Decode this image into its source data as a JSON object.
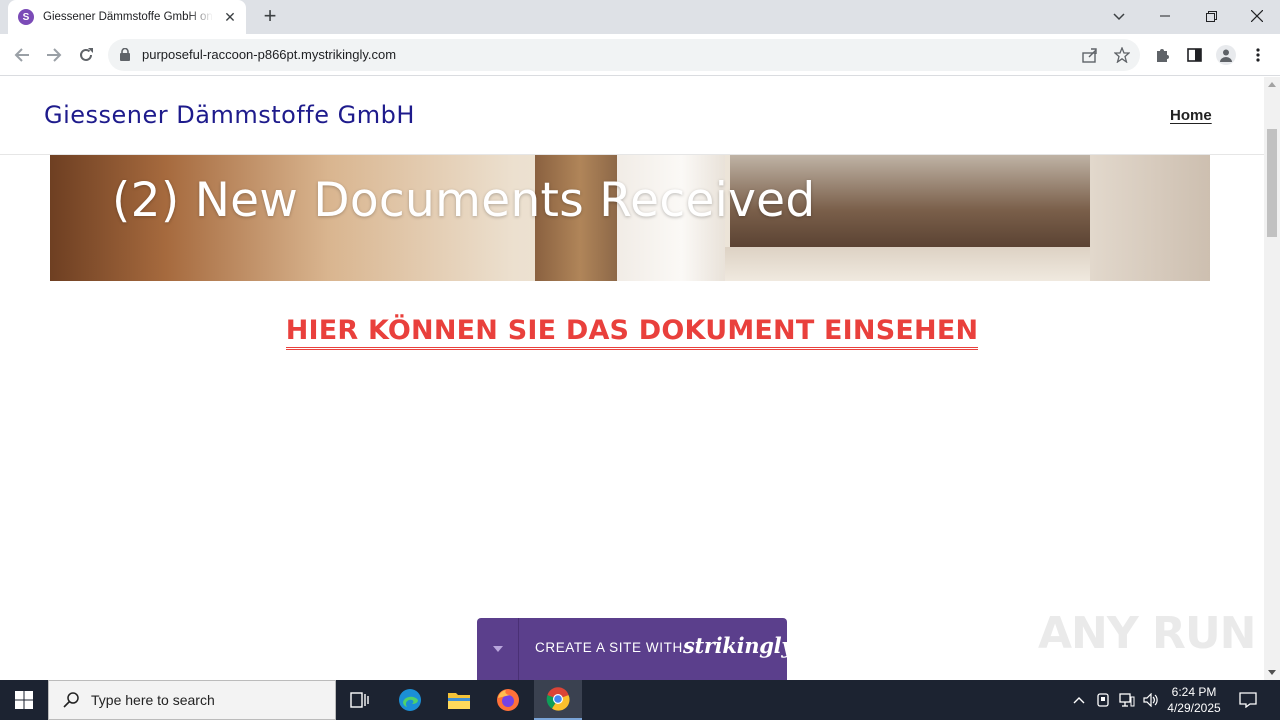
{
  "browser": {
    "tab_title": "Giessener Dämmstoffe GmbH on Strikingly",
    "favicon_letter": "S",
    "url": "purposeful-raccoon-p866pt.mystrikingly.com"
  },
  "site": {
    "title": "Giessener Dämmstoffe GmbH",
    "nav": {
      "home": "Home"
    },
    "hero_text": "(2) New Documents Received",
    "doc_link": "HIER KÖNNEN SIE DAS DOKUMENT EINSEHEN",
    "promo": {
      "prefix": "CREATE A SITE WITH",
      "brand": "strikingly"
    }
  },
  "watermark": "ANY RUN",
  "taskbar": {
    "search_placeholder": "Type here to search",
    "time": "6:24 PM",
    "date": "4/29/2025"
  },
  "colors": {
    "site_title": "#1e1b8c",
    "doc_link": "#e9403c",
    "promo_bg": "#5b3f8c",
    "taskbar_bg": "#1c2331"
  }
}
